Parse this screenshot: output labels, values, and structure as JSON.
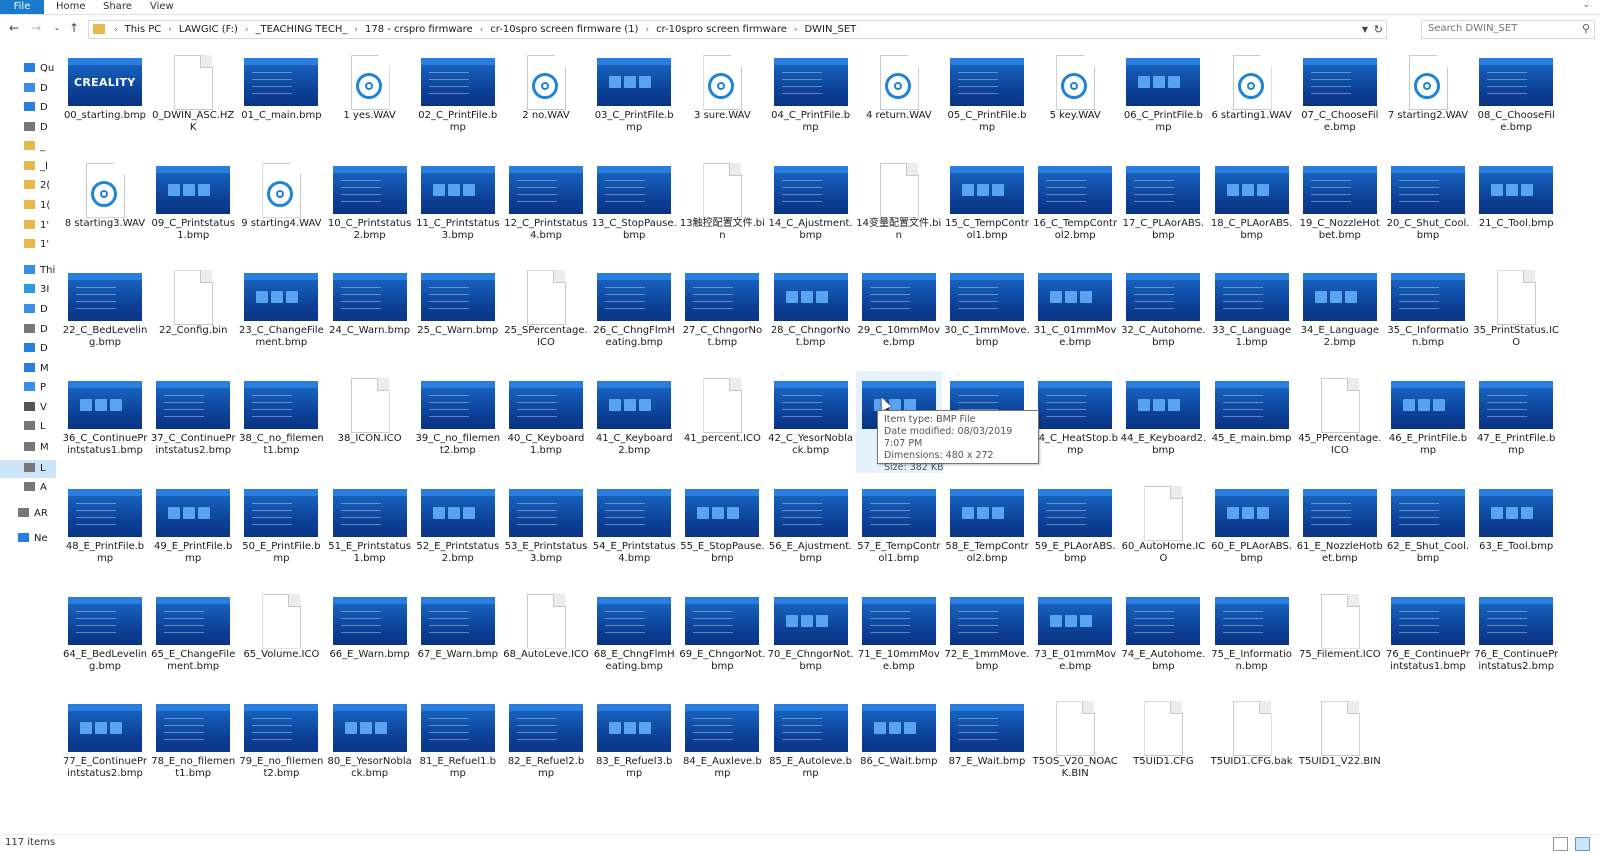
{
  "ribbon": {
    "file": "File",
    "home": "Home",
    "share": "Share",
    "view": "View"
  },
  "address": {
    "crumbs": [
      "This PC",
      "LAWGIC (F:)",
      "_TEACHING TECH_",
      "178 - crspro firmware",
      "cr-10spro screen firmware (1)",
      "cr-10spro screen firmware",
      "DWIN_SET"
    ]
  },
  "search": {
    "placeholder": "Search DWIN_SET"
  },
  "nav": {
    "items": [
      {
        "label": "Qu",
        "icon": "star-icon",
        "color": "#2a7de1"
      },
      {
        "label": "D",
        "icon": "desktop-icon",
        "color": "#3a8ee6"
      },
      {
        "label": "D",
        "icon": "download-icon",
        "color": "#2a7de1"
      },
      {
        "label": "D",
        "icon": "document-icon",
        "color": "#777777"
      },
      {
        "label": "_",
        "icon": "folder-icon",
        "color": "#e8b94a"
      },
      {
        "label": "_I",
        "icon": "folder-icon",
        "color": "#e8b94a"
      },
      {
        "label": "2(",
        "icon": "folder-icon",
        "color": "#e8b94a"
      },
      {
        "label": "1(",
        "icon": "folder-icon",
        "color": "#e8b94a"
      },
      {
        "label": "1'",
        "icon": "folder-icon",
        "color": "#e8b94a"
      },
      {
        "label": "1'",
        "icon": "folder-icon",
        "color": "#e8b94a"
      },
      {
        "label": "Thi",
        "icon": "pc-icon",
        "color": "#3a8ee6"
      },
      {
        "label": "3I",
        "icon": "3d-objects-icon",
        "color": "#2a9be0"
      },
      {
        "label": "D",
        "icon": "desktop-icon",
        "color": "#3a8ee6"
      },
      {
        "label": "D",
        "icon": "document-icon",
        "color": "#777777"
      },
      {
        "label": "D",
        "icon": "download-icon",
        "color": "#2a7de1"
      },
      {
        "label": "M",
        "icon": "music-icon",
        "color": "#2a7de1"
      },
      {
        "label": "P",
        "icon": "pictures-icon",
        "color": "#3a8ee6"
      },
      {
        "label": "V",
        "icon": "videos-icon",
        "color": "#555555"
      },
      {
        "label": "L",
        "icon": "drive-icon",
        "color": "#777777"
      },
      {
        "label": "M",
        "icon": "drive-icon",
        "color": "#777777"
      },
      {
        "label": "L",
        "icon": "drive-icon",
        "color": "#777777"
      },
      {
        "label": "A",
        "icon": "drive-icon",
        "color": "#777777"
      },
      {
        "label": "AR",
        "icon": "drive-icon",
        "color": "#777777"
      },
      {
        "label": "Ne",
        "icon": "network-icon",
        "color": "#2a7de1"
      }
    ]
  },
  "files": [
    {
      "name": "00_starting.bmp",
      "type": "logo"
    },
    {
      "name": "0_DWIN_ASC.HZK",
      "type": "doc"
    },
    {
      "name": "01_C_main.bmp",
      "type": "bmp"
    },
    {
      "name": "1 yes.WAV",
      "type": "wav"
    },
    {
      "name": "02_C_PrintFile.bmp",
      "type": "bmp"
    },
    {
      "name": "2 no.WAV",
      "type": "wav"
    },
    {
      "name": "03_C_PrintFile.bmp",
      "type": "bmp"
    },
    {
      "name": "3 sure.WAV",
      "type": "wav"
    },
    {
      "name": "04_C_PrintFile.bmp",
      "type": "bmp"
    },
    {
      "name": "4 return.WAV",
      "type": "wav"
    },
    {
      "name": "05_C_PrintFile.bmp",
      "type": "bmp"
    },
    {
      "name": "5 key.WAV",
      "type": "wav"
    },
    {
      "name": "06_C_PrintFile.bmp",
      "type": "bmp"
    },
    {
      "name": "6 starting1.WAV",
      "type": "wav"
    },
    {
      "name": "07_C_ChooseFile.bmp",
      "type": "bmp"
    },
    {
      "name": "7 starting2.WAV",
      "type": "wav"
    },
    {
      "name": "08_C_ChooseFile.bmp",
      "type": "bmp"
    },
    {
      "name": "8 starting3.WAV",
      "type": "wav"
    },
    {
      "name": "09_C_Printstatus1.bmp",
      "type": "bmp"
    },
    {
      "name": "9 starting4.WAV",
      "type": "wav"
    },
    {
      "name": "10_C_Printstatus2.bmp",
      "type": "bmp"
    },
    {
      "name": "11_C_Printstatus3.bmp",
      "type": "bmp"
    },
    {
      "name": "12_C_Printstatus4.bmp",
      "type": "bmp"
    },
    {
      "name": "13_C_StopPause.bmp",
      "type": "bmp"
    },
    {
      "name": "13触控配置文件.bin",
      "type": "doc"
    },
    {
      "name": "14_C_Ajustment.bmp",
      "type": "bmp"
    },
    {
      "name": "14变量配置文件.bin",
      "type": "doc"
    },
    {
      "name": "15_C_TempControl1.bmp",
      "type": "bmp"
    },
    {
      "name": "16_C_TempControl2.bmp",
      "type": "bmp"
    },
    {
      "name": "17_C_PLAorABS.bmp",
      "type": "bmp"
    },
    {
      "name": "18_C_PLAorABS.bmp",
      "type": "bmp"
    },
    {
      "name": "19_C_NozzleHotbet.bmp",
      "type": "bmp"
    },
    {
      "name": "20_C_Shut_Cool.bmp",
      "type": "bmp"
    },
    {
      "name": "21_C_Tool.bmp",
      "type": "bmp"
    },
    {
      "name": "22_C_BedLeveling.bmp",
      "type": "bmp"
    },
    {
      "name": "22_Config.bin",
      "type": "doc"
    },
    {
      "name": "23_C_ChangeFilement.bmp",
      "type": "bmp"
    },
    {
      "name": "24_C_Warn.bmp",
      "type": "bmp"
    },
    {
      "name": "25_C_Warn.bmp",
      "type": "bmp"
    },
    {
      "name": "25_SPercentage.ICO",
      "type": "doc"
    },
    {
      "name": "26_C_ChngFlmHeating.bmp",
      "type": "bmp"
    },
    {
      "name": "27_C_ChngorNot.bmp",
      "type": "bmp"
    },
    {
      "name": "28_C_ChngorNot.bmp",
      "type": "bmp"
    },
    {
      "name": "29_C_10mmMove.bmp",
      "type": "bmp"
    },
    {
      "name": "30_C_1mmMove.bmp",
      "type": "bmp"
    },
    {
      "name": "31_C_01mmMove.bmp",
      "type": "bmp"
    },
    {
      "name": "32_C_Autohome.bmp",
      "type": "bmp"
    },
    {
      "name": "33_C_Language1.bmp",
      "type": "bmp"
    },
    {
      "name": "34_E_Language2.bmp",
      "type": "bmp"
    },
    {
      "name": "35_C_Information.bmp",
      "type": "bmp"
    },
    {
      "name": "35_PrintStatus.ICO",
      "type": "doc"
    },
    {
      "name": "36_C_ContinuePrintstatus1.bmp",
      "type": "bmp"
    },
    {
      "name": "37_C_ContinuePrintstatus2.bmp",
      "type": "bmp"
    },
    {
      "name": "38_C_no_filement1.bmp",
      "type": "bmp"
    },
    {
      "name": "38_ICON.ICO",
      "type": "doc"
    },
    {
      "name": "39_C_no_filement2.bmp",
      "type": "bmp"
    },
    {
      "name": "40_C_Keyboard1.bmp",
      "type": "bmp"
    },
    {
      "name": "41_C_Keyboard2.bmp",
      "type": "bmp"
    },
    {
      "name": "41_percent.ICO",
      "type": "doc"
    },
    {
      "name": "42_C_YesorNoblack.bmp",
      "type": "bmp"
    },
    {
      "name": "43_C_...bmp",
      "type": "bmp",
      "display": "43",
      "display2": "mp"
    },
    {
      "name": "44_...bmp",
      "type": "bmp",
      "display": "",
      "display2": "bmp"
    },
    {
      "name": "44_C_HeatStop.bmp",
      "type": "bmp"
    },
    {
      "name": "44_E_Keyboard2.bmp",
      "type": "bmp"
    },
    {
      "name": "45_E_main.bmp",
      "type": "bmp"
    },
    {
      "name": "45_PPercentage.ICO",
      "type": "doc"
    },
    {
      "name": "46_E_PrintFile.bmp",
      "type": "bmp"
    },
    {
      "name": "47_E_PrintFile.bmp",
      "type": "bmp"
    },
    {
      "name": "48_E_PrintFile.bmp",
      "type": "bmp"
    },
    {
      "name": "49_E_PrintFile.bmp",
      "type": "bmp"
    },
    {
      "name": "50_E_PrintFile.bmp",
      "type": "bmp"
    },
    {
      "name": "51_E_Printstatus1.bmp",
      "type": "bmp"
    },
    {
      "name": "52_E_Printstatus2.bmp",
      "type": "bmp"
    },
    {
      "name": "53_E_Printstatus3.bmp",
      "type": "bmp"
    },
    {
      "name": "54_E_Printstatus4.bmp",
      "type": "bmp"
    },
    {
      "name": "55_E_StopPause.bmp",
      "type": "bmp"
    },
    {
      "name": "56_E_Ajustment.bmp",
      "type": "bmp"
    },
    {
      "name": "57_E_TempControl1.bmp",
      "type": "bmp"
    },
    {
      "name": "58_E_TempControl2.bmp",
      "type": "bmp"
    },
    {
      "name": "59_E_PLAorABS.bmp",
      "type": "bmp"
    },
    {
      "name": "60_AutoHome.ICO",
      "type": "doc"
    },
    {
      "name": "60_E_PLAorABS.bmp",
      "type": "bmp"
    },
    {
      "name": "61_E_NozzleHotbet.bmp",
      "type": "bmp"
    },
    {
      "name": "62_E_Shut_Cool.bmp",
      "type": "bmp"
    },
    {
      "name": "63_E_Tool.bmp",
      "type": "bmp"
    },
    {
      "name": "64_E_BedLeveling.bmp",
      "type": "bmp"
    },
    {
      "name": "65_E_ChangeFilement.bmp",
      "type": "bmp"
    },
    {
      "name": "65_Volume.ICO",
      "type": "doc"
    },
    {
      "name": "66_E_Warn.bmp",
      "type": "bmp"
    },
    {
      "name": "67_E_Warn.bmp",
      "type": "bmp"
    },
    {
      "name": "68_AutoLeve.ICO",
      "type": "doc"
    },
    {
      "name": "68_E_ChngFlmHeating.bmp",
      "type": "bmp"
    },
    {
      "name": "69_E_ChngorNot.bmp",
      "type": "bmp"
    },
    {
      "name": "70_E_ChngorNot.bmp",
      "type": "bmp"
    },
    {
      "name": "71_E_10mmMove.bmp",
      "type": "bmp"
    },
    {
      "name": "72_E_1mmMove.bmp",
      "type": "bmp"
    },
    {
      "name": "73_E_01mmMove.bmp",
      "type": "bmp"
    },
    {
      "name": "74_E_Autohome.bmp",
      "type": "bmp"
    },
    {
      "name": "75_E_Information.bmp",
      "type": "bmp"
    },
    {
      "name": "75_Filement.ICO",
      "type": "doc"
    },
    {
      "name": "76_E_ContinuePrintstatus1.bmp",
      "type": "bmp"
    },
    {
      "name": "76_E_ContinuePrintstatus2.bmp",
      "type": "bmp"
    },
    {
      "name": "77_E_ContinuePrintstatus2.bmp",
      "type": "bmp"
    },
    {
      "name": "78_E_no_filement1.bmp",
      "type": "bmp"
    },
    {
      "name": "79_E_no_filement2.bmp",
      "type": "bmp"
    },
    {
      "name": "80_E_YesorNoblack.bmp",
      "type": "bmp"
    },
    {
      "name": "81_E_Refuel1.bmp",
      "type": "bmp"
    },
    {
      "name": "82_E_Refuel2.bmp",
      "type": "bmp"
    },
    {
      "name": "83_E_Refuel3.bmp",
      "type": "bmp"
    },
    {
      "name": "84_E_Auxleve.bmp",
      "type": "bmp"
    },
    {
      "name": "85_E_Autoleve.bmp",
      "type": "bmp"
    },
    {
      "name": "86_C_Wait.bmp",
      "type": "bmp"
    },
    {
      "name": "87_E_Wait.bmp",
      "type": "bmp"
    },
    {
      "name": "T5OS_V20_NOACK.BIN",
      "type": "doc"
    },
    {
      "name": "T5UID1.CFG",
      "type": "doc"
    },
    {
      "name": "T5UID1.CFG.bak",
      "type": "doc"
    },
    {
      "name": "T5UID1_V22.BIN",
      "type": "doc"
    }
  ],
  "logo_text": "CREALITY",
  "tooltip": {
    "line1": "Item type: BMP File",
    "line2": "Date modified: 08/03/2019 7:07 PM",
    "line3": "Dimensions: 480 x 272",
    "line4": "Size: 382 KB"
  },
  "status": {
    "count": "117 items"
  }
}
